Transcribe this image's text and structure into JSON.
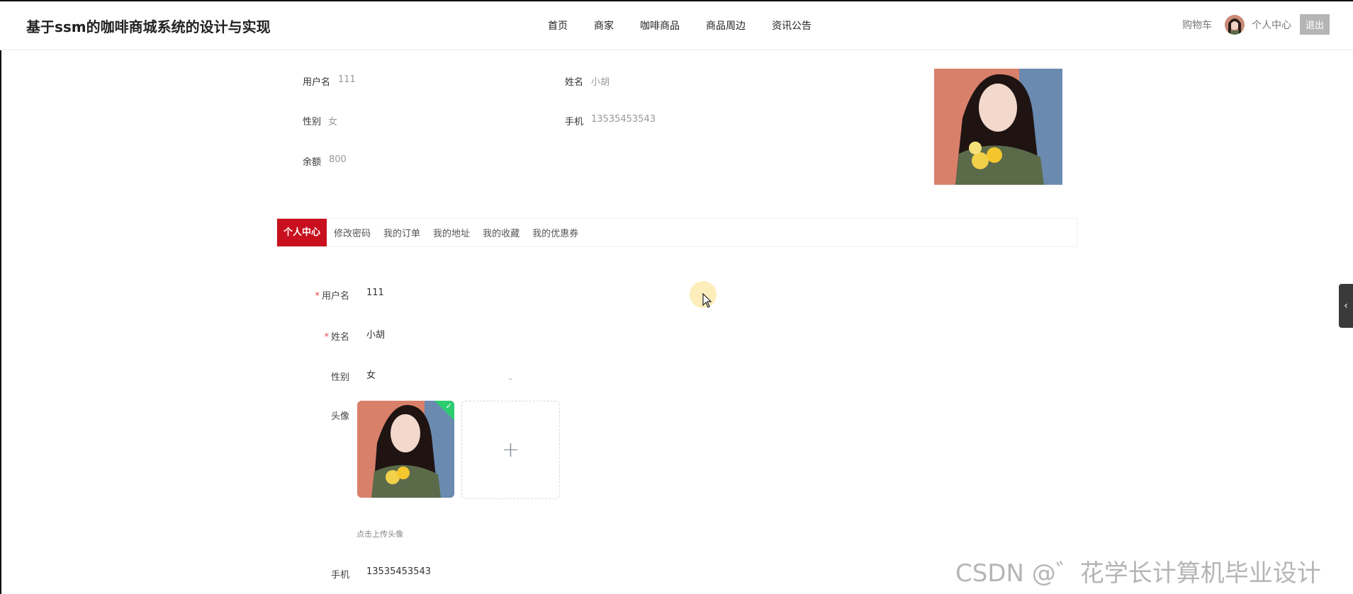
{
  "header": {
    "brand": "基于ssm的咖啡商城系统的设计与实现",
    "nav": [
      "首页",
      "商家",
      "咖啡商品",
      "商品周边",
      "资讯公告"
    ],
    "cart": "购物车",
    "user_center": "个人中心",
    "logout": "退出"
  },
  "summary": {
    "username_label": "用户名",
    "username": "111",
    "name_label": "姓名",
    "name": "小胡",
    "gender_label": "性别",
    "gender": "女",
    "phone_label": "手机",
    "phone": "13535453543",
    "balance_label": "余额",
    "balance": "800"
  },
  "tabs": [
    "个人中心",
    "修改密码",
    "我的订单",
    "我的地址",
    "我的收藏",
    "我的优惠券"
  ],
  "form": {
    "required_mark": "*",
    "username_label": "用户名",
    "username": "111",
    "name_label": "姓名",
    "name": "小胡",
    "gender_label": "性别",
    "gender": "女",
    "avatar_label": "头像",
    "upload_tip": "点击上传头像",
    "phone_label": "手机",
    "phone": "13535453543"
  },
  "watermark": "CSDN @゛花学长计算机毕业设计",
  "colors": {
    "accent": "#c8101e",
    "success": "#2ecc71"
  }
}
